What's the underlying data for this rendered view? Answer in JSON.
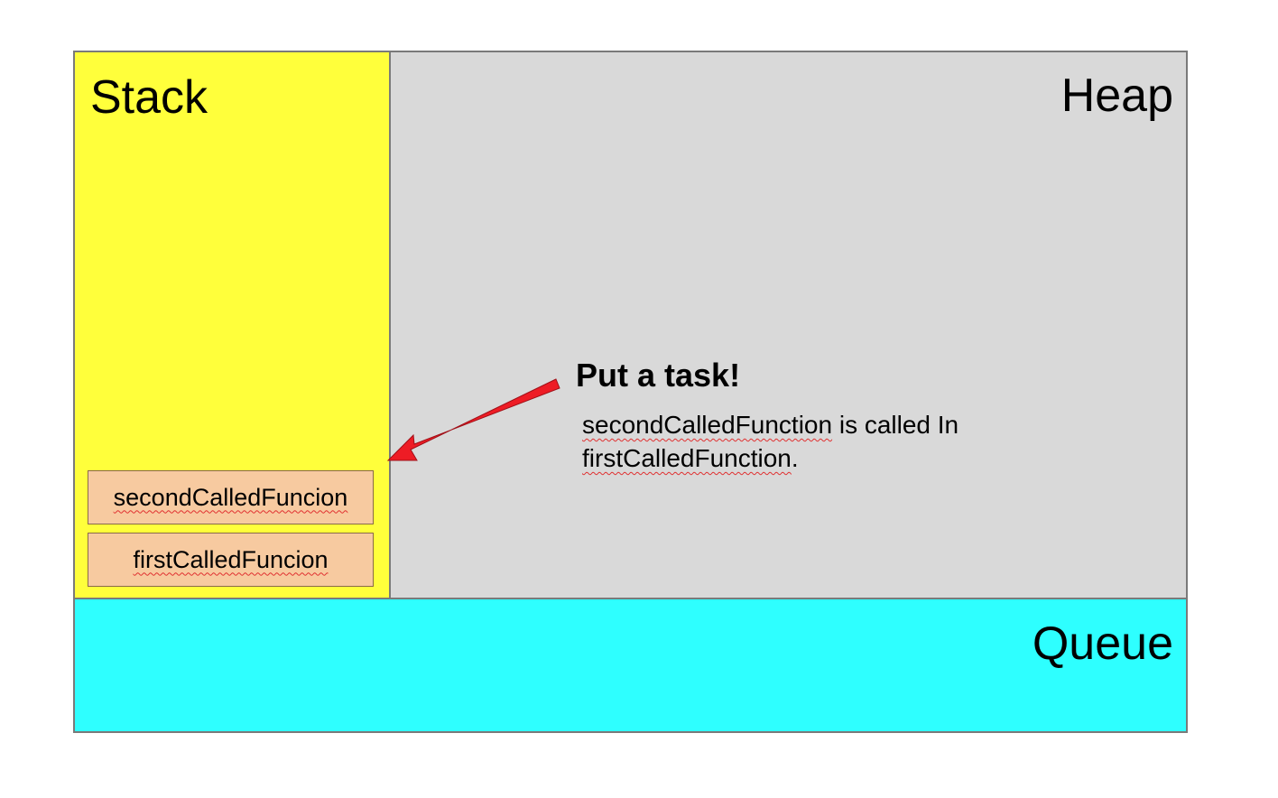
{
  "regions": {
    "stack": "Stack",
    "heap": "Heap",
    "queue": "Queue"
  },
  "stack_frames": {
    "second": "secondCalledFuncion",
    "first": "firstCalledFuncion"
  },
  "callout": {
    "title": "Put a task!",
    "body_part1": "secondCalledFunction",
    "body_part2": " is called In ",
    "body_part3": "firstCalledFunction",
    "body_part4": "."
  },
  "colors": {
    "stack": "#ffff3b",
    "heap": "#d9d9d9",
    "queue": "#2effff",
    "frame": "#f7caa0",
    "arrow": "#ee1c25"
  }
}
